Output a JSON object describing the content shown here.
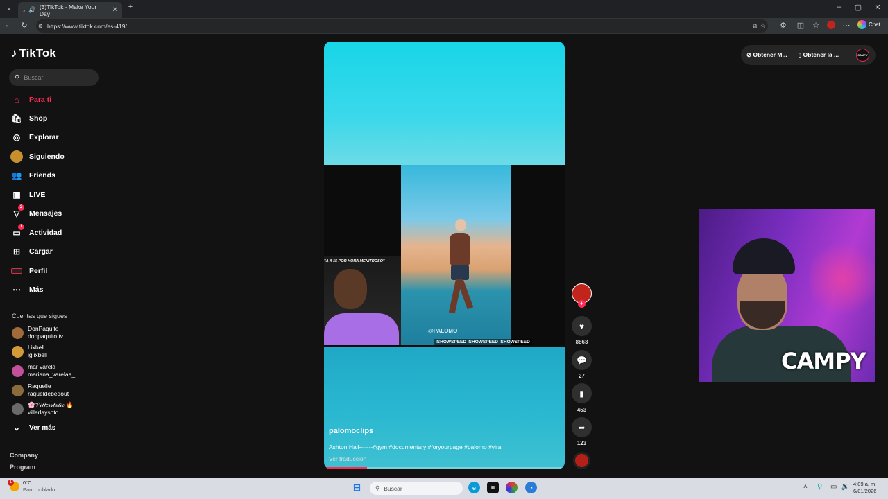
{
  "browser": {
    "tab_title": "(3)TikTok - Make Your Day",
    "url": "https://www.tiktok.com/es-419/",
    "chat_label": "Chat"
  },
  "tiktok": {
    "logo": "TikTok",
    "search_placeholder": "Buscar",
    "nav": [
      {
        "label": "Para ti",
        "icon": "home-icon",
        "active": true
      },
      {
        "label": "Shop",
        "icon": "shop-icon"
      },
      {
        "label": "Explorar",
        "icon": "compass-icon"
      },
      {
        "label": "Siguiendo",
        "icon": "following-avatar-icon"
      },
      {
        "label": "Friends",
        "icon": "friends-icon"
      },
      {
        "label": "LIVE",
        "icon": "live-icon"
      },
      {
        "label": "Mensajes",
        "icon": "messages-icon",
        "badge": "2"
      },
      {
        "label": "Actividad",
        "icon": "activity-icon",
        "badge": "1"
      },
      {
        "label": "Cargar",
        "icon": "upload-icon"
      },
      {
        "label": "Perfil",
        "icon": "profile-avatar-icon"
      },
      {
        "label": "Más",
        "icon": "more-icon"
      }
    ],
    "following_title": "Cuentas que sigues",
    "following": [
      {
        "name": "DonPaquito",
        "handle": "donpaquito.tv"
      },
      {
        "name": "Lixbell",
        "handle": "iglixbell"
      },
      {
        "name": "mar varela",
        "handle": "mariana_varelaa_"
      },
      {
        "name": "Raquelle",
        "handle": "raqueldebedout"
      },
      {
        "name": "🌸𝒱𝒾𝓁𝓁𝑒𝓇𝓈𝓉𝒶𝓉𝒾𝒸 🔥",
        "handle": "villerlaysoto"
      }
    ],
    "see_more": "Ver más",
    "footer": [
      "Company",
      "Program"
    ],
    "top_right": {
      "get_app_label": "Obtener M...",
      "get_desktop_label": "Obtener la ...",
      "avatar_text": "CAMPY"
    }
  },
  "video": {
    "inset_caption": "\"A A 15 POR HORA MENITROSO\"",
    "watermark": "@PALOMO",
    "socials": "ISHOWSPEED  ISHOWSPEED  ISHOWSPEED",
    "author": "palomoclips",
    "description": "Ashton Hall-------#gym #documentary #foryourpage #palomo #viral",
    "translate": "Ver traducción",
    "progress": 0.18,
    "likes": "8863",
    "comments": "27",
    "saves": "453",
    "shares": "123"
  },
  "webcam": {
    "name": "CAMPY"
  },
  "taskbar": {
    "weather_temp": "0°C",
    "weather_desc": "Parc. nublado",
    "weather_badge": "1",
    "search": "Buscar",
    "time": "4:09 a. m.",
    "date": "6/01/2026"
  },
  "colors": {
    "accent": "#fe2c55",
    "page_bg": "#121212"
  }
}
